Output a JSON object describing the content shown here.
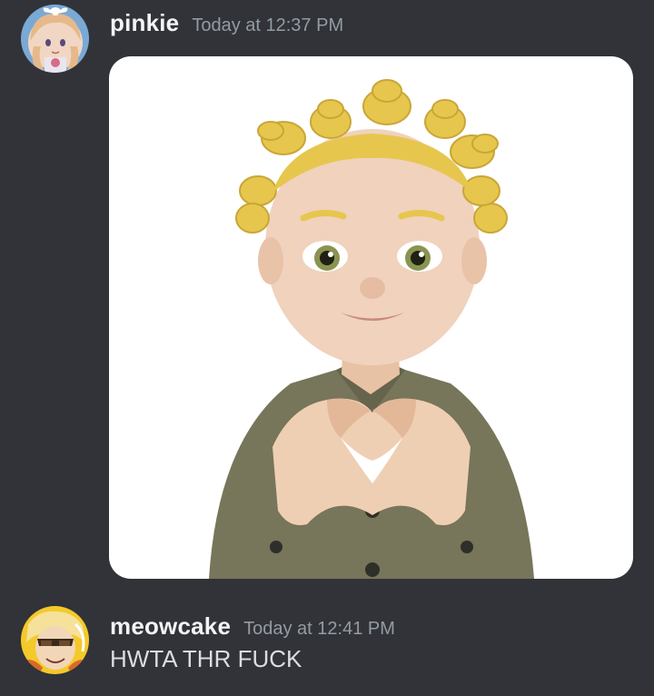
{
  "messages": [
    {
      "username": "pinkie",
      "timestamp": "Today at 12:37 PM",
      "avatar_icon": "anime-girl-avatar",
      "attachment": {
        "type": "image",
        "description_icon": "memoji-heart-hands-image"
      }
    },
    {
      "username": "meowcake",
      "timestamp": "Today at 12:41 PM",
      "avatar_icon": "cartoon-character-avatar",
      "content": "HWTA THR FUCK"
    }
  ],
  "colors": {
    "background": "#313338",
    "username": "#f2f3f5",
    "timestamp": "#949ba4",
    "message_text": "#dbdee1",
    "attachment_background": "#ffffff"
  }
}
